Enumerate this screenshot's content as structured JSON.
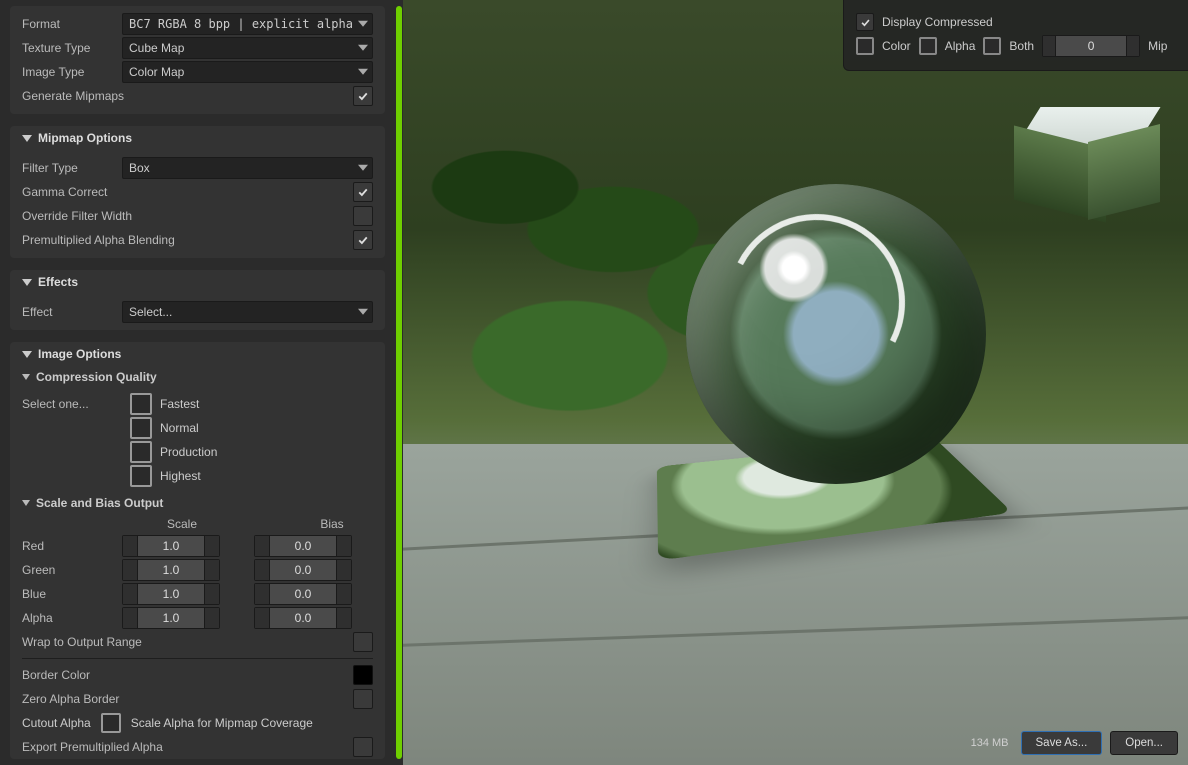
{
  "texture": {
    "format_label": "Format",
    "format_value": "BC7     RGBA   8 bpp | explicit alpha",
    "texture_type_label": "Texture Type",
    "texture_type_value": "Cube Map",
    "image_type_label": "Image Type",
    "image_type_value": "Color Map",
    "generate_mipmaps_label": "Generate Mipmaps",
    "generate_mipmaps_checked": true
  },
  "mipmap": {
    "section": "Mipmap Options",
    "filter_type_label": "Filter Type",
    "filter_type_value": "Box",
    "gamma_label": "Gamma Correct",
    "gamma_checked": true,
    "override_label": "Override Filter Width",
    "override_checked": false,
    "premult_label": "Premultiplied Alpha Blending",
    "premult_checked": true
  },
  "effects": {
    "section": "Effects",
    "effect_label": "Effect",
    "effect_value": "Select..."
  },
  "image_options": {
    "section": "Image Options",
    "compression_section": "Compression Quality",
    "select_one": "Select one...",
    "opts": [
      "Fastest",
      "Normal",
      "Production",
      "Highest"
    ]
  },
  "scale_bias": {
    "section": "Scale and Bias Output",
    "scale_h": "Scale",
    "bias_h": "Bias",
    "rows": [
      {
        "ch": "Red",
        "scale": "1.0",
        "bias": "0.0"
      },
      {
        "ch": "Green",
        "scale": "1.0",
        "bias": "0.0"
      },
      {
        "ch": "Blue",
        "scale": "1.0",
        "bias": "0.0"
      },
      {
        "ch": "Alpha",
        "scale": "1.0",
        "bias": "0.0"
      }
    ]
  },
  "misc": {
    "wrap": "Wrap to Output Range",
    "border": "Border Color",
    "zero_alpha": "Zero Alpha Border",
    "cutout": "Cutout Alpha",
    "scale_alpha": "Scale Alpha for Mipmap Coverage",
    "export_premult": "Export Premultiplied Alpha"
  },
  "overlay": {
    "display_compressed": "Display Compressed",
    "color": "Color",
    "alpha": "Alpha",
    "both": "Both",
    "mip_value": "0",
    "mip_label": "Mip"
  },
  "footer": {
    "memory": "134 MB",
    "save": "Save As...",
    "open": "Open..."
  }
}
